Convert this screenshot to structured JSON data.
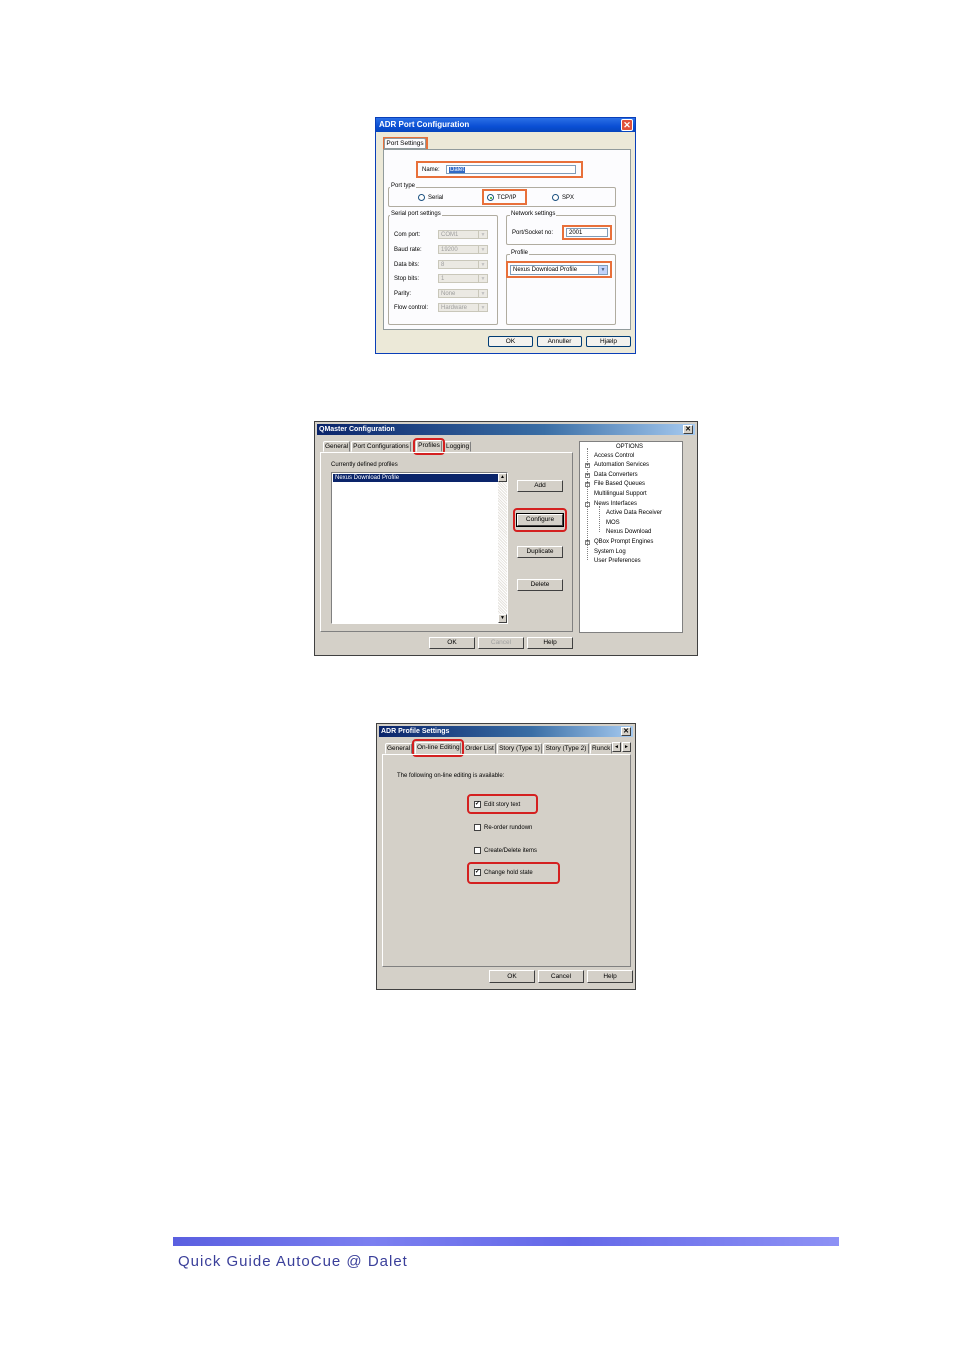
{
  "dialog1": {
    "title": "ADR Port Configuration",
    "close_glyph": "✕",
    "tab": "Port Settings",
    "name_label": "Name:",
    "name_value": "Dalet",
    "port_type": {
      "label": "Port type",
      "options": [
        "Serial",
        "TCP/IP",
        "SPX"
      ],
      "selected": "TCP/IP"
    },
    "serial": {
      "label": "Serial port settings",
      "fields": [
        {
          "label": "Com port:",
          "value": "COM1"
        },
        {
          "label": "Baud rate:",
          "value": "19200"
        },
        {
          "label": "Data bits:",
          "value": "8"
        },
        {
          "label": "Stop bits:",
          "value": "1"
        },
        {
          "label": "Parity:",
          "value": "None"
        },
        {
          "label": "Flow control:",
          "value": "Hardware"
        }
      ]
    },
    "network": {
      "label": "Network settings",
      "port_label": "Port/Socket no:",
      "port_value": "2001"
    },
    "profile": {
      "label": "Profile",
      "value": "Nexus Download Profile"
    },
    "buttons": {
      "ok": "OK",
      "cancel": "Annuller",
      "help": "Hjælp"
    }
  },
  "dialog2": {
    "title": "QMaster Configuration",
    "close_glyph": "✕",
    "tabs": [
      "General",
      "Port Configurations",
      "Profiles",
      "Logging"
    ],
    "active_tab": "Profiles",
    "list_label": "Currently defined profiles",
    "profiles": [
      "Nexus Download Profile"
    ],
    "buttons": {
      "add": "Add",
      "configure": "Configure",
      "duplicate": "Duplicate",
      "delete": "Delete"
    },
    "tree": [
      {
        "label": "OPTIONS",
        "level": 0,
        "expander": ""
      },
      {
        "label": "Access Control",
        "level": 1,
        "expander": ""
      },
      {
        "label": "Automation Services",
        "level": 1,
        "expander": "+"
      },
      {
        "label": "Data Converters",
        "level": 1,
        "expander": "+"
      },
      {
        "label": "File Based Queues",
        "level": 1,
        "expander": "+"
      },
      {
        "label": "Multilingual Support",
        "level": 1,
        "expander": ""
      },
      {
        "label": "News Interfaces",
        "level": 1,
        "expander": "-"
      },
      {
        "label": "Active Data Receiver",
        "level": 2,
        "expander": ""
      },
      {
        "label": "MOS",
        "level": 2,
        "expander": ""
      },
      {
        "label": "Nexus Download",
        "level": 2,
        "expander": ""
      },
      {
        "label": "QBox Prompt Engines",
        "level": 1,
        "expander": "+"
      },
      {
        "label": "System Log",
        "level": 1,
        "expander": ""
      },
      {
        "label": "User Preferences",
        "level": 1,
        "expander": ""
      }
    ],
    "footer_buttons": {
      "ok": "OK",
      "cancel": "Cancel",
      "help": "Help"
    }
  },
  "dialog3": {
    "title": "ADR Profile Settings",
    "close_glyph": "✕",
    "tabs": [
      "General",
      "On-line Editing",
      "Order List",
      "Story (Type 1)",
      "Story (Type 2)",
      "Runck"
    ],
    "active_tab": "On-line Editing",
    "intro": "The following on-line editing is available:",
    "options": [
      {
        "label": "Edit story text",
        "checked": true
      },
      {
        "label": "Re-order rundown",
        "checked": false
      },
      {
        "label": "Create/Delete items",
        "checked": false
      },
      {
        "label": "Change hold state",
        "checked": true
      }
    ],
    "check_glyph": "✓",
    "scroll_left": "◄",
    "scroll_right": "►",
    "buttons": {
      "ok": "OK",
      "cancel": "Cancel",
      "help": "Help"
    }
  },
  "footer": {
    "text": "Quick Guide AutoCue @ Dalet"
  },
  "colors": {
    "dialog_face": "#d4d0c8",
    "xp_titlebar": "#0a4fd4",
    "highlight_orange": "#e8703a",
    "highlight_red": "#d42020",
    "footer_text": "#3a3f9a"
  }
}
